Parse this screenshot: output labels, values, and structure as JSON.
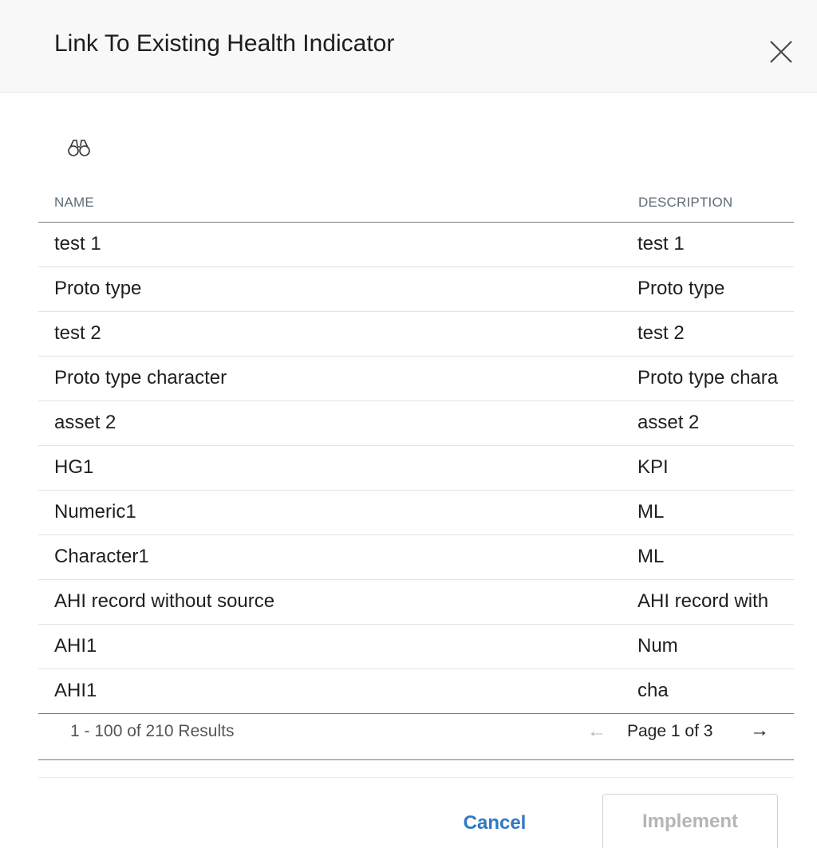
{
  "dialog": {
    "title": "Link To Existing Health Indicator",
    "close_icon": "close-icon",
    "search_icon": "binoculars-icon"
  },
  "table": {
    "columns": [
      "NAME",
      "DESCRIPTION"
    ],
    "rows": [
      {
        "name": "test 1",
        "description": "test 1"
      },
      {
        "name": "Proto type",
        "description": "Proto type"
      },
      {
        "name": "test 2",
        "description": "test 2"
      },
      {
        "name": "Proto type character",
        "description": "Proto type chara"
      },
      {
        "name": "asset 2",
        "description": "asset 2"
      },
      {
        "name": "HG1",
        "description": "KPI"
      },
      {
        "name": "Numeric1",
        "description": "ML"
      },
      {
        "name": "Character1",
        "description": "ML"
      },
      {
        "name": "AHI record without source",
        "description": "AHI record with"
      },
      {
        "name": "AHI1",
        "description": "Num"
      },
      {
        "name": "AHI1",
        "description": "cha"
      }
    ]
  },
  "pager": {
    "results": "1 - 100 of 210 Results",
    "page_label": "Page 1 of 3",
    "prev_icon": "arrow-left-icon",
    "next_icon": "arrow-right-icon"
  },
  "footer": {
    "cancel_label": "Cancel",
    "implement_label": "Implement"
  },
  "colors": {
    "header_bg": "#f8f8f8",
    "link_blue": "#2f78c4",
    "disabled_text": "#b5b5b5",
    "divider_dark": "#7b7b7b"
  }
}
